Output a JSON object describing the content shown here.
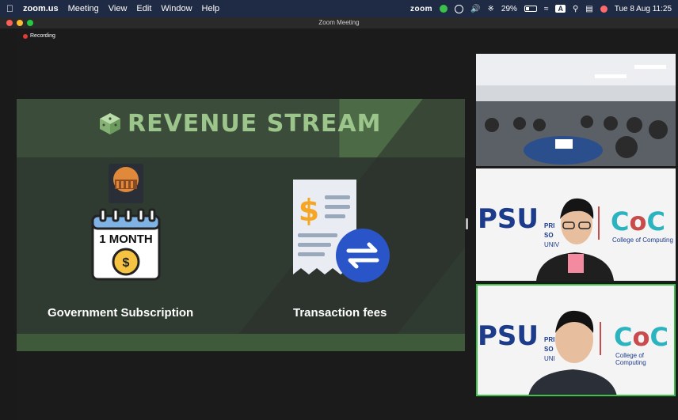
{
  "menubar": {
    "app": "zoom.us",
    "items": [
      "Meeting",
      "View",
      "Edit",
      "Window",
      "Help"
    ],
    "status": {
      "zoom": "zoom",
      "battery": "29%",
      "datetime": "Tue 8 Aug  11:25",
      "input": "A"
    }
  },
  "window": {
    "title": "Zoom Meeting",
    "recording": "Recording"
  },
  "slide": {
    "title": "REVENUE STREAM",
    "items": [
      {
        "label": "Government Subscription",
        "badge": "1 MONTH",
        "logo_text": "GOVERNMENT OFFICE"
      },
      {
        "label": "Transaction fees"
      }
    ]
  },
  "participants": {
    "tile2": {
      "org_left": "PSU",
      "org_lines": [
        "PRI",
        "SO",
        "UNIV"
      ],
      "coc": "CoC",
      "coc_sub": "College of Computing"
    },
    "tile3": {
      "org_left": "PSU",
      "org_lines": [
        "PRI",
        "SO",
        "UNI"
      ],
      "coc": "CoC",
      "coc_sub": "College of Computing"
    }
  },
  "colors": {
    "slide_green": "#9cc58b",
    "active_speaker": "#3cc14a",
    "psu_blue": "#1c3b8a"
  }
}
